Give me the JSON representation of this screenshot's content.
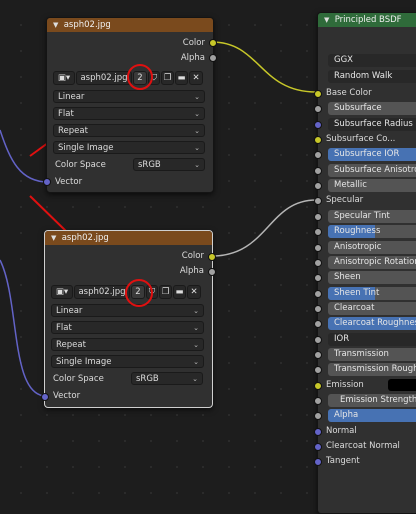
{
  "node1": {
    "title": "asph02.jpg",
    "outputs": [
      "Color",
      "Alpha"
    ],
    "image_name": "asph02.jpg",
    "users": "2",
    "interpolation": "Linear",
    "projection": "Flat",
    "extension": "Repeat",
    "source": "Single Image",
    "color_space_label": "Color Space",
    "color_space": "sRGB",
    "input": "Vector"
  },
  "node2": {
    "title": "asph02.jpg",
    "outputs": [
      "Color",
      "Alpha"
    ],
    "image_name": "asph02.jpg",
    "users": "2",
    "interpolation": "Linear",
    "projection": "Flat",
    "extension": "Repeat",
    "source": "Single Image",
    "color_space_label": "Color Space",
    "color_space": "sRGB",
    "input": "Vector"
  },
  "bsdf": {
    "title": "Principled BSDF",
    "distribution": "GGX",
    "subsurface_method": "Random Walk",
    "rows": [
      {
        "label": "Base Color",
        "kind": "label"
      },
      {
        "label": "Subsurface",
        "kind": "box"
      },
      {
        "label": "Subsurface Radius",
        "kind": "dark"
      },
      {
        "label": "Subsurface Co...",
        "kind": "label"
      },
      {
        "label": "Subsurface IOR",
        "kind": "blue"
      },
      {
        "label": "Subsurface Anisotropy",
        "kind": "box"
      },
      {
        "label": "Metallic",
        "kind": "box"
      },
      {
        "label": "Specular",
        "kind": "label"
      },
      {
        "label": "Specular Tint",
        "kind": "box"
      },
      {
        "label": "Roughness",
        "kind": "half"
      },
      {
        "label": "Anisotropic",
        "kind": "box"
      },
      {
        "label": "Anisotropic Rotation",
        "kind": "box"
      },
      {
        "label": "Sheen",
        "kind": "box"
      },
      {
        "label": "Sheen Tint",
        "kind": "half"
      },
      {
        "label": "Clearcoat",
        "kind": "box"
      },
      {
        "label": "Clearcoat Roughness",
        "kind": "blue"
      },
      {
        "label": "IOR",
        "kind": "dark"
      },
      {
        "label": "Transmission",
        "kind": "box"
      },
      {
        "label": "Transmission Roughness",
        "kind": "box"
      },
      {
        "label": "Emission",
        "kind": "label"
      },
      {
        "label": "Emission Strength",
        "kind": "box"
      },
      {
        "label": "Alpha",
        "kind": "blue"
      },
      {
        "label": "Normal",
        "kind": "label"
      },
      {
        "label": "Clearcoat Normal",
        "kind": "label"
      },
      {
        "label": "Tangent",
        "kind": "label"
      }
    ]
  },
  "colors": {
    "texture_header": "#7a4a1d",
    "shader_header": "#2f6b3a",
    "color_socket": "#c7c729",
    "float_socket": "#a1a1a1",
    "vector_socket": "#6363c7",
    "slider_fill": "#4772b3",
    "annotation": "#e01010"
  }
}
